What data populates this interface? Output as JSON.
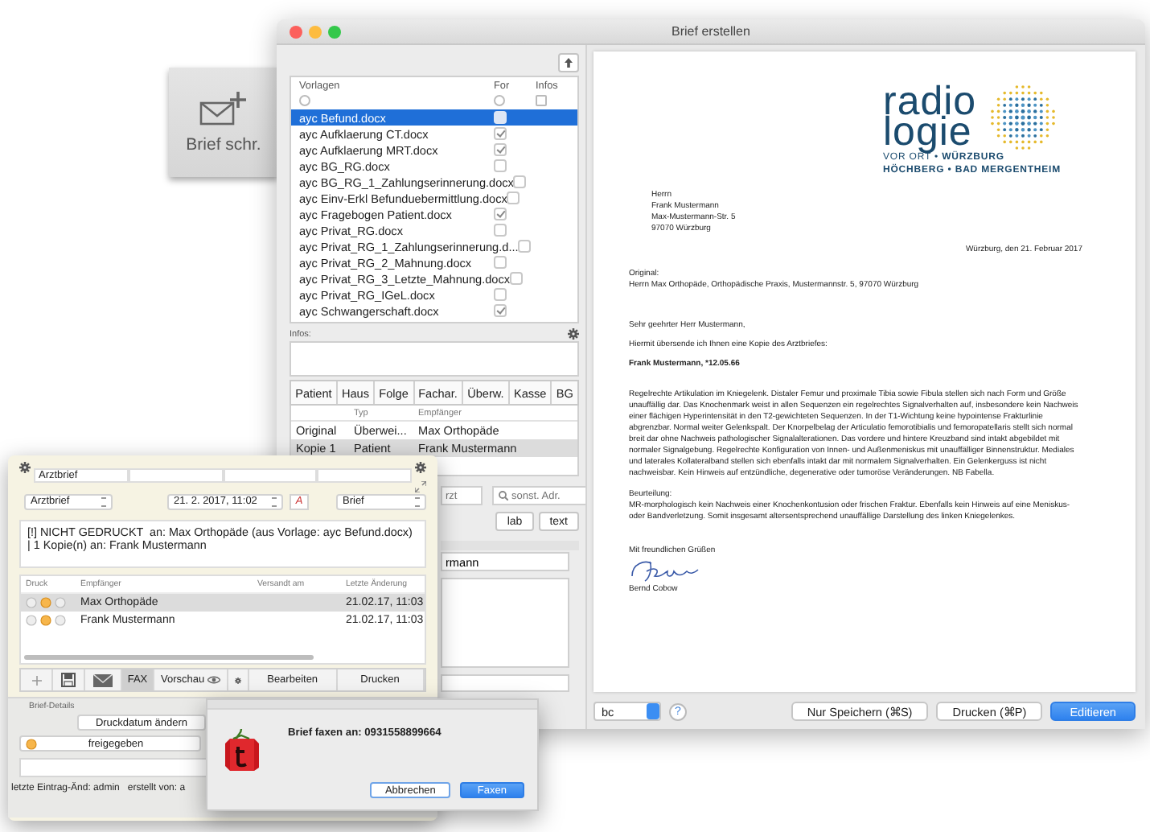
{
  "tile": {
    "label": "Brief schr."
  },
  "main_window": {
    "title": "Brief erstellen",
    "templates": {
      "columns": [
        {
          "label": "Vorlagen",
          "checked": false
        },
        {
          "label": "For",
          "checked": false
        },
        {
          "label": "Infos",
          "checked": false
        }
      ],
      "rows": [
        {
          "name": "ayc Befund.docx",
          "for": false,
          "selected": true
        },
        {
          "name": "ayc Aufklaerung CT.docx",
          "for": true,
          "selected": false
        },
        {
          "name": "ayc Aufklaerung MRT.docx",
          "for": true,
          "selected": false
        },
        {
          "name": "ayc BG_RG.docx",
          "for": false,
          "selected": false
        },
        {
          "name": "ayc BG_RG_1_Zahlungserinnerung.docx",
          "for": false,
          "selected": false
        },
        {
          "name": "ayc Einv-Erkl Befunduebermittlung.docx",
          "for": false,
          "selected": false
        },
        {
          "name": "ayc Fragebogen Patient.docx",
          "for": true,
          "selected": false
        },
        {
          "name": "ayc Privat_RG.docx",
          "for": false,
          "selected": false
        },
        {
          "name": "ayc Privat_RG_1_Zahlungserinnerung.d...",
          "for": false,
          "selected": false
        },
        {
          "name": "ayc Privat_RG_2_Mahnung.docx",
          "for": false,
          "selected": false
        },
        {
          "name": "ayc Privat_RG_3_Letzte_Mahnung.docx",
          "for": false,
          "selected": false
        },
        {
          "name": "ayc Privat_RG_IGeL.docx",
          "for": false,
          "selected": false
        },
        {
          "name": "ayc Schwangerschaft.docx",
          "for": true,
          "selected": false
        }
      ]
    },
    "infos_label": "Infos:",
    "recipient_tabs": [
      "Patient",
      "Haus",
      "Folge",
      "Fachar.",
      "Überw.",
      "Kasse",
      "BG"
    ],
    "recipients": {
      "columns": [
        "Typ",
        "Empfänger"
      ],
      "rows": [
        {
          "copy": "Original",
          "type": "Überwei...",
          "recipient": "Max Orthopäde",
          "selected": false
        },
        {
          "copy": "Kopie 1",
          "type": "Patient",
          "recipient": "Frank Mustermann",
          "selected": true
        }
      ]
    },
    "address_field": {
      "placeholder": "rzt"
    },
    "search_field": {
      "placeholder": "sonst. Adr."
    },
    "buttons": [
      "lab",
      "text"
    ],
    "recipient_field": {
      "value": "rmann"
    },
    "document": {
      "logo": {
        "word_1": "radio",
        "word_2": "logie",
        "tagline_1": "VOR ORT • **WÜRZBURG**",
        "tagline_2": "HÖCHBERG • BAD MERGENTHEIM"
      },
      "address": [
        "Herrn",
        "Frank Mustermann",
        "Max-Mustermann-Str. 5",
        "97070 Würzburg"
      ],
      "date": "Würzburg, den 21. Februar 2017",
      "original_label": "Original:",
      "original": "Herrn Max Orthopäde, Orthopädische Praxis, Mustermannstr. 5, 97070 Würzburg",
      "salutation": "Sehr geehrter Herr Mustermann,",
      "intro": "Hiermit übersende ich Ihnen eine Kopie des Arztbriefes:",
      "patient": "Frank Mustermann, *12.05.66",
      "findings": "Regelrechte Artikulation im Kniegelenk. Distaler Femur und proximale Tibia sowie Fibula stellen sich nach Form und Größe unauffällig dar. Das Knochenmark weist in allen Sequenzen ein regelrechtes Signalverhalten auf, insbesondere kein Nachweis einer flächigen Hyperintensität in den T2-gewichteten Sequenzen. In der T1-Wichtung keine hypointense Frakturlinie abgrenzbar. Normal weiter Gelenkspalt. Der Knorpelbelag der Articulatio femorotibialis und femoropatellaris stellt sich normal breit dar ohne Nachweis pathologischer Signalalterationen. Das vordere und hintere Kreuzband sind intakt abgebildet mit normaler Signalgebung. Regelrechte Konfiguration von Innen- und Außenmeniskus mit unauffälliger Binnenstruktur. Mediales und laterales Kollateralband stellen sich ebenfalls intakt dar mit normalem Signalverhalten. Ein Gelenkerguss ist nicht nachweisbar. Kein Hinweis auf entzündliche, degenerative oder tumoröse Veränderungen. NB Fabella.",
      "assessment_label": "Beurteilung:",
      "assessment": "MR-morphologisch kein Nachweis einer Knochenkontusion oder frischen Fraktur. Ebenfalls kein Hinweis auf eine Meniskus- oder Bandverletzung. Somit insgesamt altersentsprechend unauffällige Darstellung des linken Kniegelenkes.",
      "closing": "Mit freundlichen Grüßen",
      "signer": "Bernd Cobow"
    },
    "footer": {
      "select": "bc",
      "help": "?",
      "buttons": [
        {
          "label": "Nur Speichern (⌘S)",
          "primary": false
        },
        {
          "label": "Drucken (⌘P)",
          "primary": false
        },
        {
          "label": "Editieren",
          "primary": true
        }
      ]
    }
  },
  "letter_window": {
    "title_field": "Arztbrief",
    "type_select": "Arztbrief",
    "date": "21. 2. 2017, 11:02",
    "font_button": "A",
    "format_select": "Brief",
    "status_lines": [
      "[!] NICHT GEDRUCKT  an: Max Orthopäde (aus Vorlage: ayc Befund.docx)",
      "| 1 Kopie(n) an: Frank Mustermann"
    ],
    "table": {
      "columns": [
        "Druck",
        "Empfänger",
        "Versandt am",
        "Letzte Änderung"
      ],
      "rows": [
        {
          "recipient": "Max Orthopäde",
          "changed": "21.02.17, 11:03",
          "selected": true
        },
        {
          "recipient": "Frank Mustermann",
          "changed": "21.02.17, 11:03",
          "selected": false
        }
      ]
    },
    "toolbar": {
      "fax": {
        "label": "FAX",
        "active": true
      },
      "preview": "Vorschau",
      "buttons": [
        "Bearbeiten",
        "Drucken"
      ]
    },
    "details_label": "Brief-Details",
    "date_button": "Druckdatum ändern",
    "release_status": "freigegeben",
    "footer": [
      "letzte Eintrag-Änd: admin",
      "erstellt von: a"
    ]
  },
  "fax_dialog": {
    "message": "Brief faxen an: 0931558899664",
    "buttons": [
      {
        "label": "Abbrechen",
        "primary": false
      },
      {
        "label": "Faxen",
        "primary": true
      }
    ]
  }
}
